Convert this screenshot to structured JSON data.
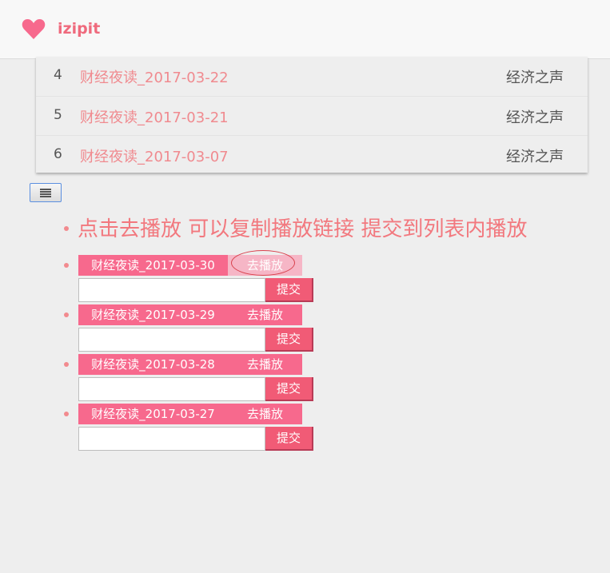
{
  "header": {
    "brand": "izipit",
    "logo_icon": "heart-icon",
    "accent": "#f7698d"
  },
  "table": {
    "rows": [
      {
        "index": "4",
        "title": "财经夜读_2017-03-22",
        "source": "经济之声"
      },
      {
        "index": "5",
        "title": "财经夜读_2017-03-21",
        "source": "经济之声"
      },
      {
        "index": "6",
        "title": "财经夜读_2017-03-07",
        "source": "经济之声"
      }
    ]
  },
  "menu_button": {
    "icon": "menu-lines-icon"
  },
  "instruction": "点击去播放 可以复制播放链接 提交到列表内播放",
  "items": [
    {
      "title": "财经夜读_2017-03-30",
      "play_label": "去播放",
      "input_value": "",
      "submit_label": "提交"
    },
    {
      "title": "财经夜读_2017-03-29",
      "play_label": "去播放",
      "input_value": "",
      "submit_label": "提交"
    },
    {
      "title": "财经夜读_2017-03-28",
      "play_label": "去播放",
      "input_value": "",
      "submit_label": "提交"
    },
    {
      "title": "财经夜读_2017-03-27",
      "play_label": "去播放",
      "input_value": "",
      "submit_label": "提交"
    }
  ]
}
